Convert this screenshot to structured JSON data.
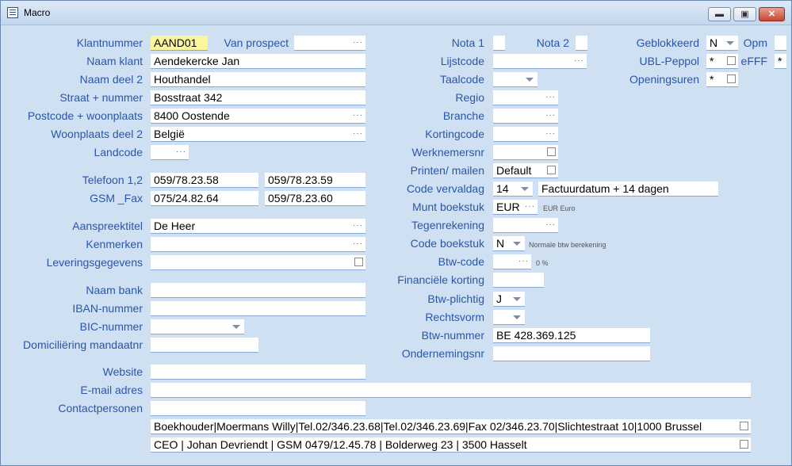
{
  "window": {
    "title": "Macro",
    "btn_min": "▬",
    "btn_max": "▣",
    "btn_close": "✕"
  },
  "left": {
    "klantnummer": {
      "label": "Klantnummer",
      "value": "AAND01"
    },
    "van_prospect": {
      "label": "Van prospect",
      "value": ""
    },
    "naam_klant": {
      "label": "Naam klant",
      "value": "Aendekercke Jan"
    },
    "naam_deel2": {
      "label": "Naam deel 2",
      "value": "Houthandel"
    },
    "straat": {
      "label": "Straat + nummer",
      "value": "Bosstraat 342"
    },
    "postcode": {
      "label": "Postcode + woonplaats",
      "value": "8400 Oostende"
    },
    "woonplaats2": {
      "label": "Woonplaats deel 2",
      "value": "België"
    },
    "landcode": {
      "label": "Landcode",
      "value": ""
    },
    "telefoon": {
      "label": "Telefoon 1,2",
      "value1": "059/78.23.58",
      "value2": "059/78.23.59"
    },
    "gsm": {
      "label": "GSM _Fax",
      "value1": "075/24.82.64",
      "value2": "059/78.23.60"
    },
    "aanspreektitel": {
      "label": "Aanspreektitel",
      "value": "De Heer"
    },
    "kenmerken": {
      "label": "Kenmerken",
      "value": ""
    },
    "levering": {
      "label": "Leveringsgegevens",
      "value": ""
    },
    "naam_bank": {
      "label": "Naam bank",
      "value": ""
    },
    "iban": {
      "label": "IBAN-nummer",
      "value": ""
    },
    "bic": {
      "label": "BIC-nummer",
      "value": ""
    },
    "domiciliering": {
      "label": "Domiciliëring mandaatnr",
      "value": ""
    },
    "website": {
      "label": "Website",
      "value": ""
    },
    "email": {
      "label": "E-mail adres",
      "value": ""
    },
    "contactpersonen": {
      "label": "Contactpersonen",
      "value": ""
    },
    "contact_rows": [
      "Boekhouder|Moermans Willy|Tel.02/346.23.68|Tel.02/346.23.69|Fax 02/346.23.70|Slichtestraat 10|1000 Brussel",
      "CEO | Johan Devriendt | GSM 0479/12.45.78 | Bolderweg 23 | 3500 Hasselt"
    ]
  },
  "mid": {
    "nota1": {
      "label": "Nota 1"
    },
    "nota2": {
      "label": "Nota 2"
    },
    "lijstcode": {
      "label": "Lijstcode",
      "value": ""
    },
    "taalcode": {
      "label": "Taalcode",
      "value": ""
    },
    "regio": {
      "label": "Regio",
      "value": ""
    },
    "branche": {
      "label": "Branche",
      "value": ""
    },
    "kortingcode": {
      "label": "Kortingcode",
      "value": ""
    },
    "werknemersnr": {
      "label": "Werknemersnr",
      "value": ""
    },
    "printen": {
      "label": "Printen/ mailen",
      "value": "Default"
    },
    "vervaldag": {
      "label": "Code vervaldag",
      "value": "14",
      "desc": "Factuurdatum + 14 dagen"
    },
    "munt": {
      "label": "Munt boekstuk",
      "value": "EUR",
      "hint": "EUR Euro"
    },
    "tegenrekening": {
      "label": "Tegenrekening",
      "value": ""
    },
    "code_boekstuk": {
      "label": "Code boekstuk",
      "value": "N",
      "hint": "Normale btw berekening"
    },
    "btw_code": {
      "label": "Btw-code",
      "value": "",
      "hint": "0 %"
    },
    "fin_korting": {
      "label": "Financiële korting",
      "value": ""
    },
    "btw_plichtig": {
      "label": "Btw-plichtig",
      "value": "J"
    },
    "rechtsvorm": {
      "label": "Rechtsvorm",
      "value": ""
    },
    "btw_nummer": {
      "label": "Btw-nummer",
      "value": "BE 428.369.125"
    },
    "ondernemingsnr": {
      "label": "Ondernemingsnr",
      "value": ""
    }
  },
  "right": {
    "geblokkeerd": {
      "label": "Geblokkeerd",
      "value": "N"
    },
    "opm": {
      "label": "Opm"
    },
    "ubl": {
      "label": "UBL-Peppol",
      "value": "*"
    },
    "efff": {
      "label": "eFFF",
      "value": "*"
    },
    "openingsuren": {
      "label": "Openingsuren",
      "value": "*"
    }
  },
  "icons": {
    "dots": "···"
  }
}
